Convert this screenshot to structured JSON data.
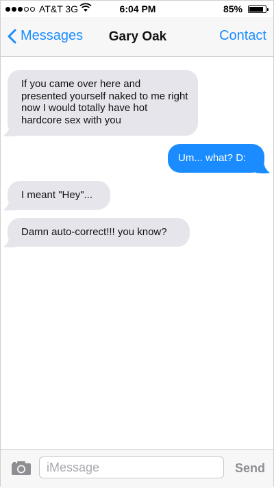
{
  "status_bar": {
    "signal_bars_filled": 3,
    "signal_bars_total": 5,
    "carrier": "AT&T 3G",
    "time": "6:04 PM",
    "battery_percent": "85%",
    "battery_level": 0.85
  },
  "nav": {
    "back_label": "Messages",
    "title": "Gary Oak",
    "contact_label": "Contact"
  },
  "messages": [
    {
      "direction": "received",
      "text": "If you came over here and presented yourself naked to me right now I would totally have hot hardcore sex with you"
    },
    {
      "direction": "sent",
      "text": "Um... what? D:"
    },
    {
      "direction": "received",
      "text": "I meant \"Hey\"..."
    },
    {
      "direction": "received",
      "text": "Damn auto-correct!!! you know?"
    }
  ],
  "input": {
    "placeholder": "iMessage",
    "value": "",
    "send_label": "Send"
  },
  "colors": {
    "accent": "#1a8cff",
    "received_bubble": "#e6e5eb",
    "send_disabled": "#8e8e93"
  },
  "icons": [
    "wifi-icon",
    "battery-icon",
    "chevron-left-icon",
    "camera-icon"
  ]
}
